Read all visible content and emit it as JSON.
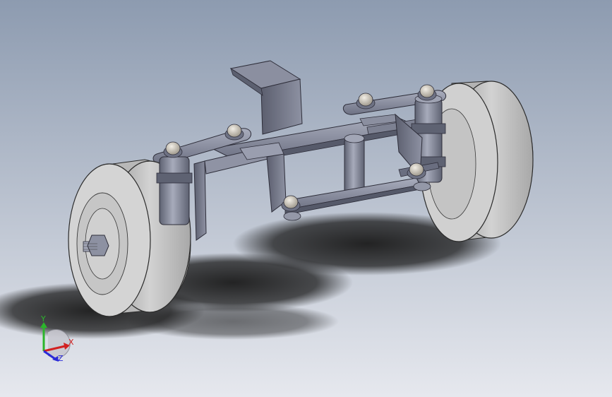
{
  "viewport": {
    "background_top": "#8d9bb0",
    "background_bottom": "#e6e8ee",
    "shadow_color": "#1a1a1a"
  },
  "model": {
    "part_color": "#7e8294",
    "part_dark": "#4f5263",
    "part_light": "#a9adbd",
    "wheel_color": "#c9c9c9",
    "wheel_dark": "#8e8e8e",
    "fastener_color": "#d8d2c6"
  },
  "triad": {
    "axes": [
      {
        "name": "y",
        "label": "Y",
        "color": "#2bb52b"
      },
      {
        "name": "x",
        "label": "X",
        "color": "#d22020"
      },
      {
        "name": "z",
        "label": "Z",
        "color": "#2a2ad8"
      }
    ]
  }
}
